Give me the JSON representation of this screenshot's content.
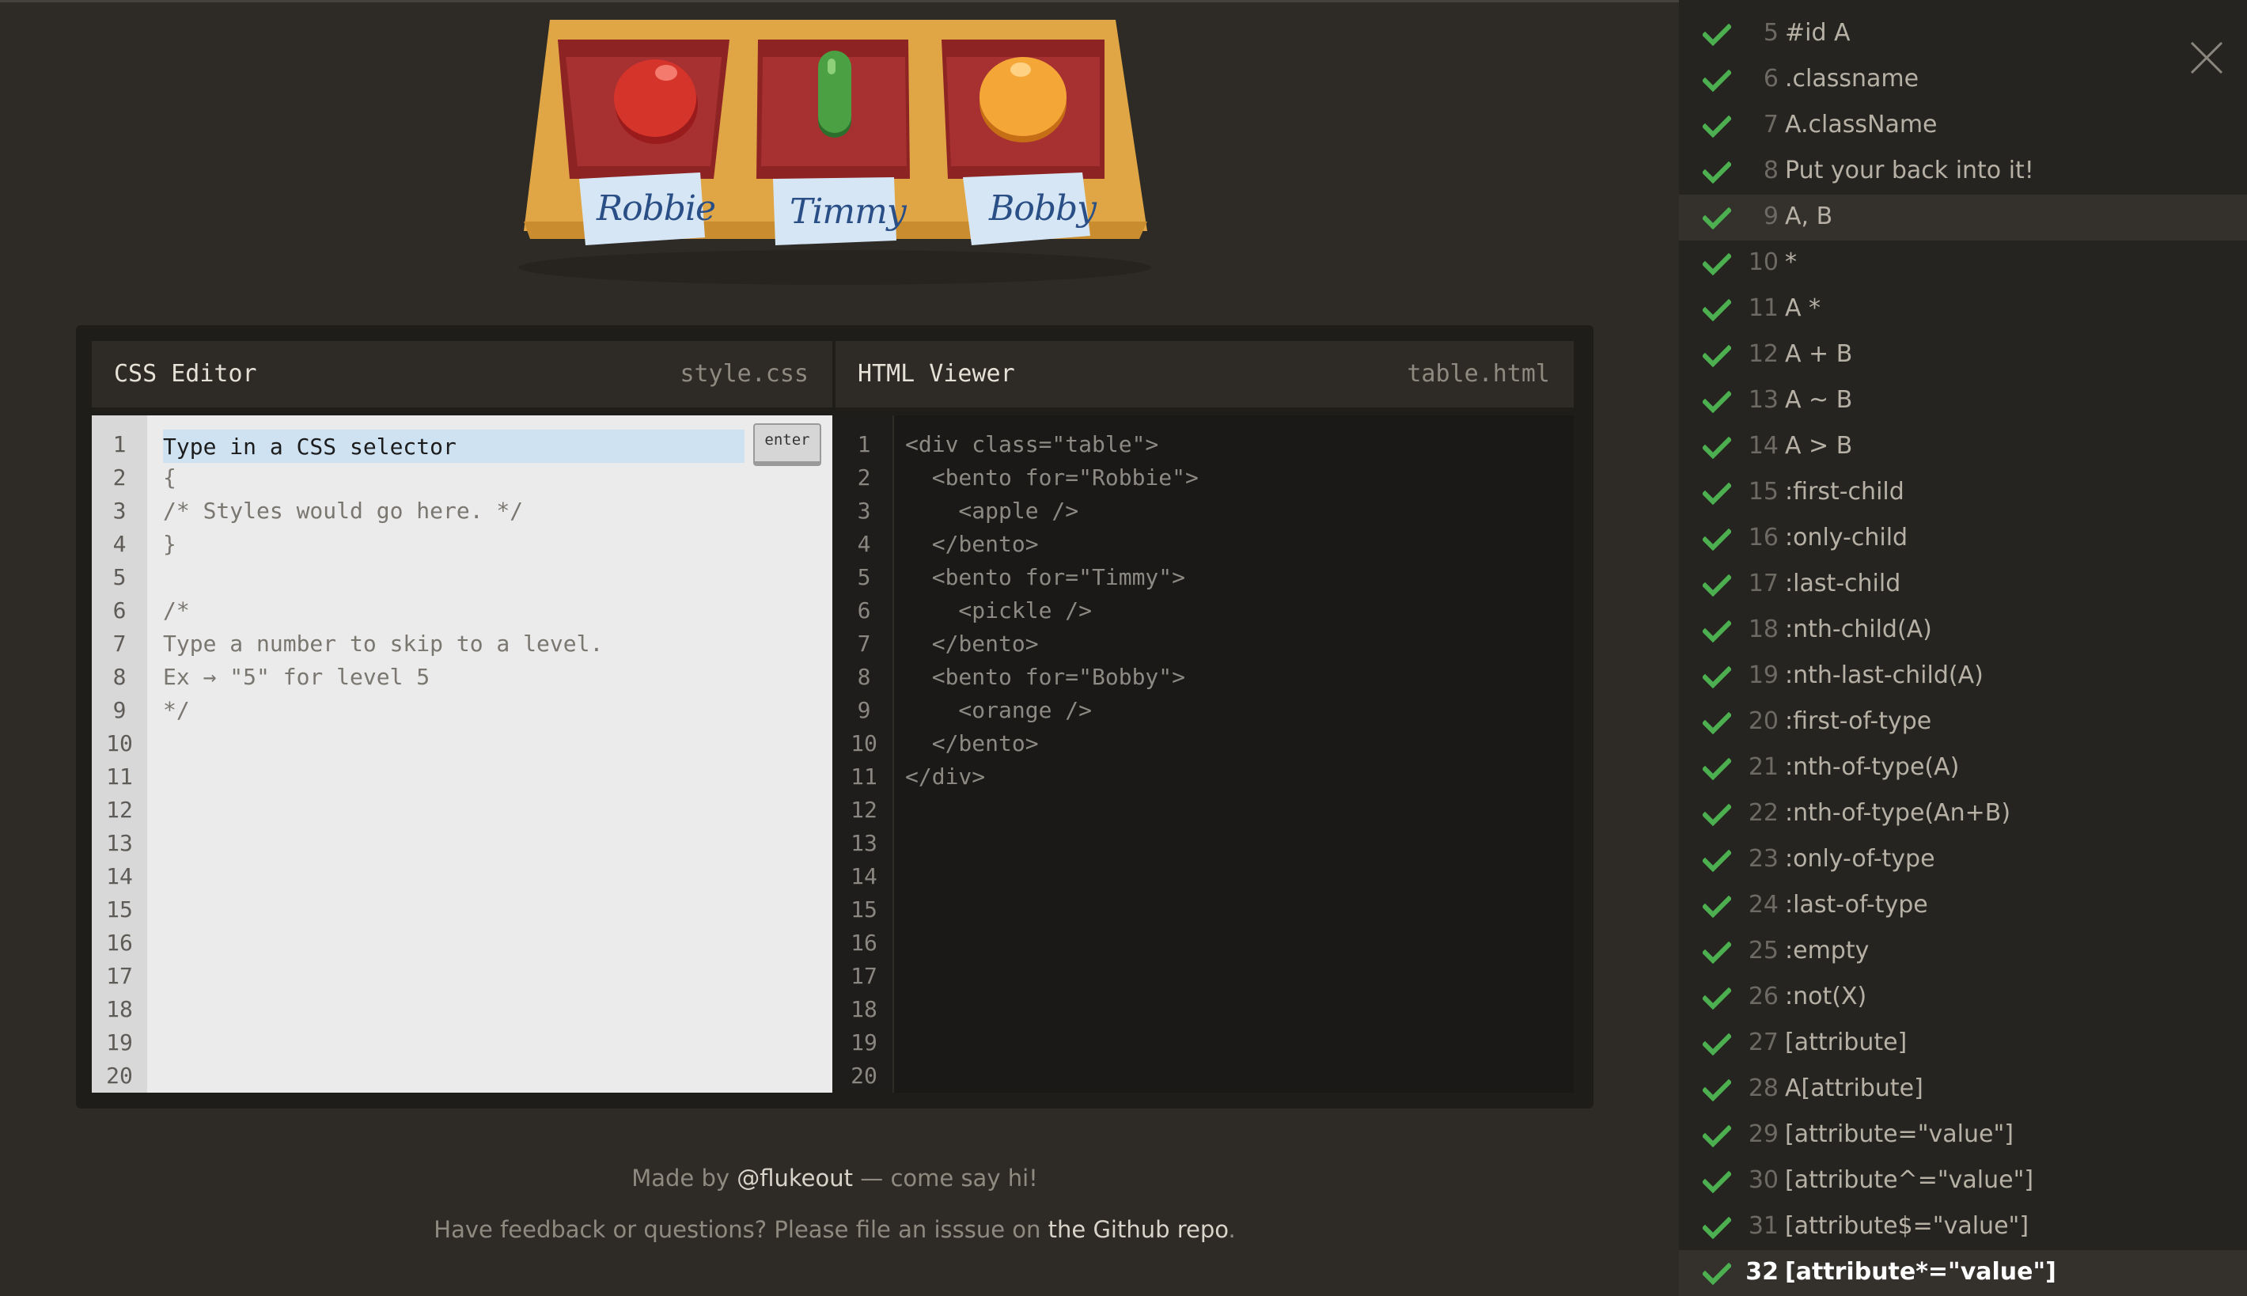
{
  "illustration": {
    "names": [
      "Robbie",
      "Timmy",
      "Bobby"
    ]
  },
  "editor": {
    "css_title": "CSS Editor",
    "css_file": "style.css",
    "html_title": "HTML Viewer",
    "html_file": "table.html",
    "input_placeholder": "Type in a CSS selector",
    "enter_label": "enter",
    "line_numbers": [
      "1",
      "2",
      "3",
      "4",
      "5",
      "6",
      "7",
      "8",
      "9",
      "10",
      "11",
      "12",
      "13",
      "14",
      "15",
      "16",
      "17",
      "18",
      "19",
      "20"
    ],
    "css_lines": [
      "",
      "{",
      "/* Styles would go here. */",
      "}",
      "",
      "/*",
      "Type a number to skip to a level.",
      "Ex → \"5\" for level 5",
      "*/"
    ],
    "html_lines": [
      "<div class=\"table\">",
      "  <bento for=\"Robbie\">",
      "    <apple />",
      "  </bento>",
      "  <bento for=\"Timmy\">",
      "    <pickle />",
      "  </bento>",
      "  <bento for=\"Bobby\">",
      "    <orange />",
      "  </bento>",
      "</div>"
    ]
  },
  "footer": {
    "made_by_prefix": "Made by ",
    "made_by_link": "@flukeout",
    "made_by_suffix": " — come say hi!",
    "feedback_prefix": "Have feedback or questions? Please file an isssue on ",
    "feedback_link": "the Github repo",
    "feedback_suffix": "."
  },
  "sidebar": {
    "levels": [
      {
        "num": "5",
        "name": "#id A",
        "completed": true
      },
      {
        "num": "6",
        "name": ".classname",
        "completed": true
      },
      {
        "num": "7",
        "name": "A.className",
        "completed": true
      },
      {
        "num": "8",
        "name": "Put your back into it!",
        "completed": true
      },
      {
        "num": "9",
        "name": "A, B",
        "completed": true,
        "hover": true
      },
      {
        "num": "10",
        "name": "*",
        "completed": true
      },
      {
        "num": "11",
        "name": "A *",
        "completed": true
      },
      {
        "num": "12",
        "name": "A + B",
        "completed": true
      },
      {
        "num": "13",
        "name": "A ~ B",
        "completed": true
      },
      {
        "num": "14",
        "name": "A > B",
        "completed": true
      },
      {
        "num": "15",
        "name": ":first-child",
        "completed": true
      },
      {
        "num": "16",
        "name": ":only-child",
        "completed": true
      },
      {
        "num": "17",
        "name": ":last-child",
        "completed": true
      },
      {
        "num": "18",
        "name": ":nth-child(A)",
        "completed": true
      },
      {
        "num": "19",
        "name": ":nth-last-child(A)",
        "completed": true
      },
      {
        "num": "20",
        "name": ":first-of-type",
        "completed": true
      },
      {
        "num": "21",
        "name": ":nth-of-type(A)",
        "completed": true
      },
      {
        "num": "22",
        "name": ":nth-of-type(An+B)",
        "completed": true
      },
      {
        "num": "23",
        "name": ":only-of-type",
        "completed": true
      },
      {
        "num": "24",
        "name": ":last-of-type",
        "completed": true
      },
      {
        "num": "25",
        "name": ":empty",
        "completed": true
      },
      {
        "num": "26",
        "name": ":not(X)",
        "completed": true
      },
      {
        "num": "27",
        "name": "[attribute]",
        "completed": true
      },
      {
        "num": "28",
        "name": "A[attribute]",
        "completed": true
      },
      {
        "num": "29",
        "name": "[attribute=\"value\"]",
        "completed": true
      },
      {
        "num": "30",
        "name": "[attribute^=\"value\"]",
        "completed": true
      },
      {
        "num": "31",
        "name": "[attribute$=\"value\"]",
        "completed": true
      },
      {
        "num": "32",
        "name": "[attribute*=\"value\"]",
        "completed": true,
        "current": true
      }
    ]
  },
  "colors": {
    "check": "#4caf50",
    "accent_input": "#cfe2f2"
  }
}
